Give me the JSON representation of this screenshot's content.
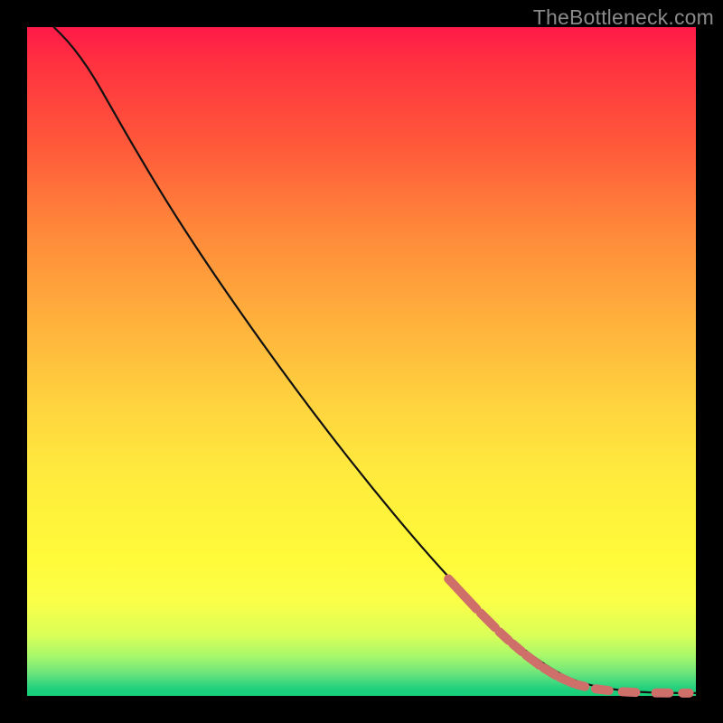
{
  "watermark": "TheBottleneck.com",
  "chart_data": {
    "type": "line",
    "title": "",
    "xlabel": "",
    "ylabel": "",
    "xlim": [
      0,
      100
    ],
    "ylim": [
      0,
      100
    ],
    "grid": false,
    "series": [
      {
        "name": "curve",
        "color": "#111111",
        "x": [
          4,
          6,
          8,
          10,
          12,
          16,
          22,
          30,
          40,
          50,
          60,
          68,
          74,
          80,
          84,
          88,
          92,
          95,
          98,
          100
        ],
        "y": [
          100,
          98,
          95.5,
          92.5,
          89,
          82,
          72,
          60,
          46,
          33,
          21,
          12.5,
          7,
          3,
          1.6,
          0.9,
          0.55,
          0.45,
          0.42,
          0.42
        ]
      },
      {
        "name": "dashed-overlay",
        "color": "#cf6f6a",
        "segments": [
          {
            "x0": 63.0,
            "y0": 17.5,
            "x1": 67.2,
            "y1": 13.0
          },
          {
            "x0": 67.8,
            "y0": 12.4,
            "x1": 70.0,
            "y1": 10.2
          },
          {
            "x0": 70.6,
            "y0": 9.6,
            "x1": 72.0,
            "y1": 8.3
          },
          {
            "x0": 72.6,
            "y0": 7.8,
            "x1": 74.0,
            "y1": 6.6
          },
          {
            "x0": 74.6,
            "y0": 6.1,
            "x1": 76.6,
            "y1": 4.6
          },
          {
            "x0": 77.2,
            "y0": 4.2,
            "x1": 79.0,
            "y1": 3.1
          },
          {
            "x0": 79.6,
            "y0": 2.8,
            "x1": 81.6,
            "y1": 1.9
          },
          {
            "x0": 82.2,
            "y0": 1.7,
            "x1": 83.4,
            "y1": 1.4
          },
          {
            "x0": 85.0,
            "y0": 1.05,
            "x1": 87.0,
            "y1": 0.8
          },
          {
            "x0": 89.0,
            "y0": 0.62,
            "x1": 91.0,
            "y1": 0.52
          },
          {
            "x0": 94.0,
            "y0": 0.45,
            "x1": 96.0,
            "y1": 0.44
          },
          {
            "x0": 98.0,
            "y0": 0.43,
            "x1": 99.0,
            "y1": 0.43
          }
        ]
      }
    ]
  }
}
